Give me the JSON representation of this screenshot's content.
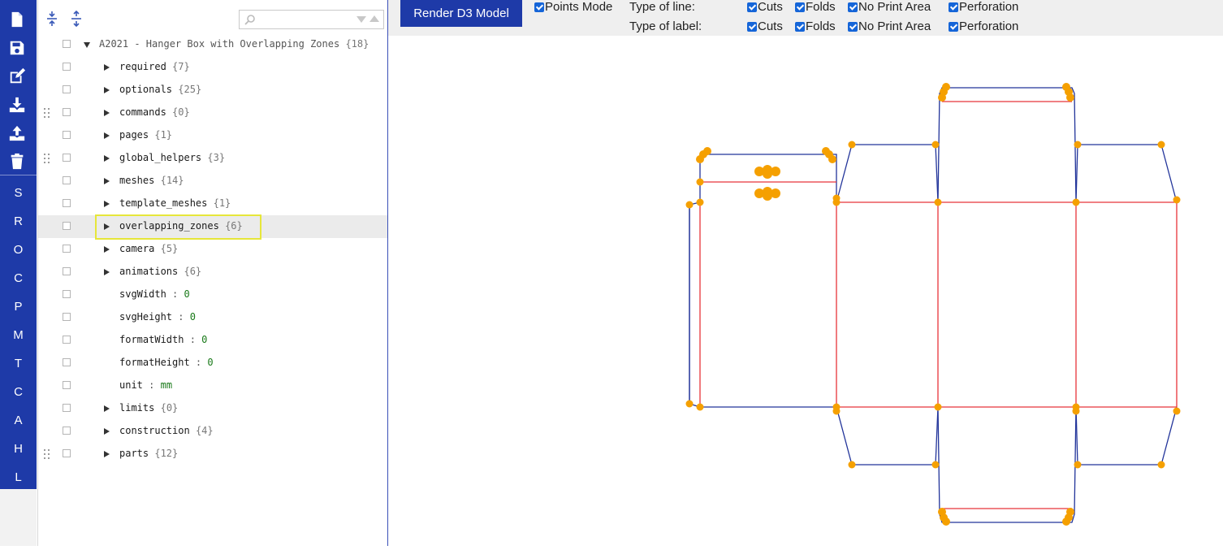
{
  "toolbar": {
    "render_button": "Render D3 Model",
    "points_mode": "Points Mode",
    "type_of_line": "Type of line:",
    "type_of_label": "Type of label:",
    "options": [
      "Cuts",
      "Folds",
      "No Print Area",
      "Perforation"
    ]
  },
  "sidebar": {
    "icons": [
      "new-file-icon",
      "save-icon",
      "edit-icon",
      "download-icon",
      "upload-icon",
      "trash-icon"
    ],
    "letters": [
      "S",
      "R",
      "O",
      "C",
      "P",
      "M",
      "T",
      "C",
      "A",
      "H",
      "L"
    ],
    "colors": {
      "rail": "#1e3aa8",
      "highlight_outline": "#e6e63a"
    }
  },
  "tree": {
    "search": {
      "value": "",
      "placeholder": ""
    },
    "root": {
      "label": "A2021 - Hanger Box with Overlapping Zones",
      "count": "{18}"
    },
    "items": [
      {
        "key": "required",
        "count": "{7}"
      },
      {
        "key": "optionals",
        "count": "{25}"
      },
      {
        "key": "commands",
        "count": "{0}"
      },
      {
        "key": "pages",
        "count": "{1}"
      },
      {
        "key": "global_helpers",
        "count": "{3}"
      },
      {
        "key": "meshes",
        "count": "{14}"
      },
      {
        "key": "template_meshes",
        "count": "{1}"
      },
      {
        "key": "overlapping_zones",
        "count": "{6}"
      },
      {
        "key": "camera",
        "count": "{5}"
      },
      {
        "key": "animations",
        "count": "{6}"
      },
      {
        "key": "svgWidth",
        "value": "0"
      },
      {
        "key": "svgHeight",
        "value": "0"
      },
      {
        "key": "formatWidth",
        "value": "0"
      },
      {
        "key": "formatHeight",
        "value": "0"
      },
      {
        "key": "unit",
        "value": "mm"
      },
      {
        "key": "limits",
        "count": "{0}"
      },
      {
        "key": "construction",
        "count": "{4}"
      },
      {
        "key": "parts",
        "count": "{12}"
      }
    ]
  },
  "canvas": {
    "colors": {
      "cut": "#22349a",
      "fold": "#e8343a",
      "point": "#f5a000"
    }
  }
}
